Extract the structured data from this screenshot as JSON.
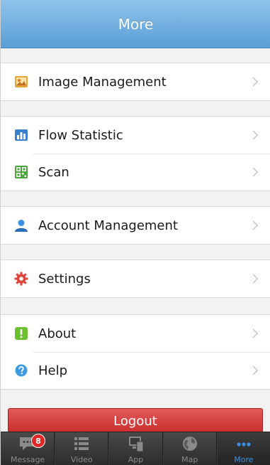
{
  "header": {
    "title": "More"
  },
  "menu": {
    "image_management": "Image Management",
    "flow_statistic": "Flow Statistic",
    "scan": "Scan",
    "account_management": "Account Management",
    "settings": "Settings",
    "about": "About",
    "help": "Help"
  },
  "logout": {
    "label": "Logout"
  },
  "tabs": [
    {
      "label": "Message",
      "icon": "chat-bubble-icon",
      "badge": "8"
    },
    {
      "label": "Video",
      "icon": "list-icon"
    },
    {
      "label": "App",
      "icon": "devices-icon"
    },
    {
      "label": "Map",
      "icon": "globe-icon"
    },
    {
      "label": "More",
      "icon": "more-dots-icon"
    }
  ],
  "colors": {
    "header": "#5a9fd7",
    "logout": "#d13a3a",
    "active_tab": "#3a8fe0",
    "badge": "#e02828"
  }
}
